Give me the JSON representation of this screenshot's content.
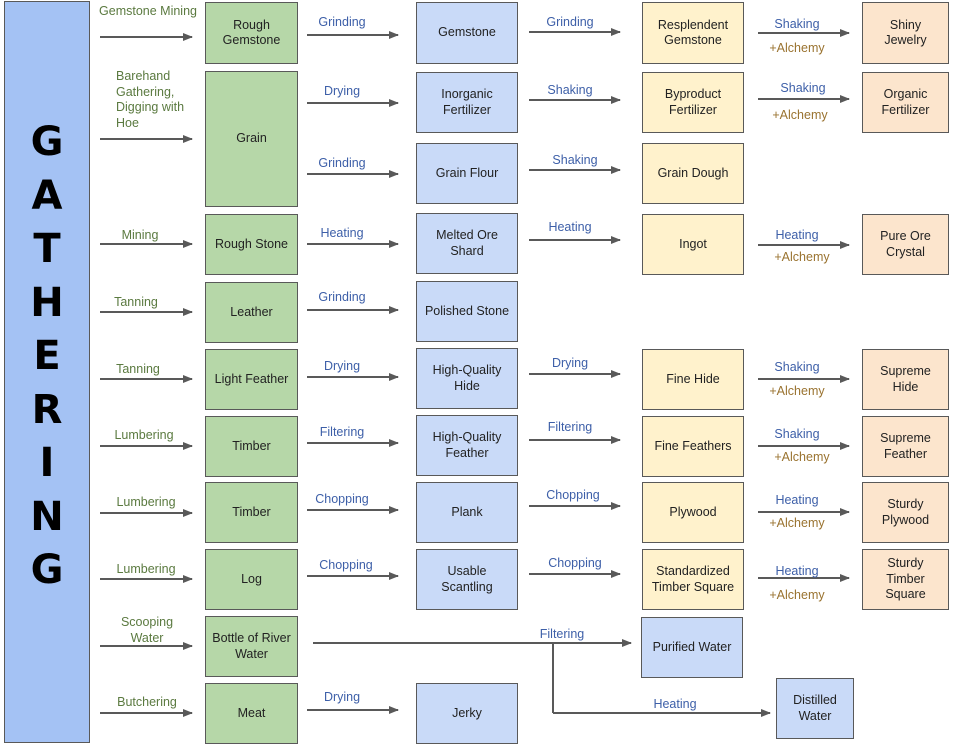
{
  "banner": {
    "title_letters": [
      "G",
      "A",
      "T",
      "H",
      "E",
      "R",
      "I",
      "N",
      "G"
    ]
  },
  "colors": {
    "gathered": "#b6d7a8",
    "processed": "#c9daf8",
    "refined": "#fff2cc",
    "alchemy_product": "#fce5cd",
    "banner": "#a4c2f4",
    "gather_label": "#5b7a40",
    "process_label": "#3d5fa8",
    "alchemy_label": "#9a7330"
  },
  "rows": [
    {
      "gather": "Gemstone Mining",
      "raw": "Rough Gemstone",
      "steps": [
        {
          "process": "Grinding",
          "item": "Gemstone"
        },
        {
          "process": "Grinding",
          "item": "Resplendent Gemstone"
        },
        {
          "process": "Shaking",
          "modifier": "+Alchemy",
          "item": "Shiny Jewelry"
        }
      ]
    },
    {
      "gather": "Barehand Gathering, Digging with Hoe",
      "raw": "Grain",
      "branches": [
        {
          "steps": [
            {
              "process": "Drying",
              "item": "Inorganic Fertilizer"
            },
            {
              "process": "Shaking",
              "item": "Byproduct Fertilizer"
            },
            {
              "process": "Shaking",
              "modifier": "+Alchemy",
              "item": "Organic Fertilizer"
            }
          ]
        },
        {
          "steps": [
            {
              "process": "Grinding",
              "item": "Grain Flour"
            },
            {
              "process": "Shaking",
              "item": "Grain Dough"
            }
          ]
        }
      ]
    },
    {
      "gather": "Mining",
      "raw": "Rough Stone",
      "steps": [
        {
          "process": "Heating",
          "item": "Melted Ore Shard"
        },
        {
          "process": "Heating",
          "item": "Ingot"
        },
        {
          "process": "Heating",
          "modifier": "+Alchemy",
          "item": "Pure Ore Crystal"
        }
      ]
    },
    {
      "gather": "Tanning",
      "raw": "Leather",
      "steps": [
        {
          "process": "Grinding",
          "item": "Polished Stone"
        }
      ]
    },
    {
      "gather": "Tanning",
      "raw": "Light Feather",
      "steps": [
        {
          "process": "Drying",
          "item": "High-Quality Hide"
        },
        {
          "process": "Drying",
          "item": "Fine Hide"
        },
        {
          "process": "Shaking",
          "modifier": "+Alchemy",
          "item": "Supreme Hide"
        }
      ]
    },
    {
      "gather": "Lumbering",
      "raw": "Timber",
      "steps": [
        {
          "process": "Filtering",
          "item": "High-Quality Feather"
        },
        {
          "process": "Filtering",
          "item": "Fine Feathers"
        },
        {
          "process": "Shaking",
          "modifier": "+Alchemy",
          "item": "Supreme Feather"
        }
      ]
    },
    {
      "gather": "Lumbering",
      "raw": "Timber",
      "steps": [
        {
          "process": "Chopping",
          "item": "Plank"
        },
        {
          "process": "Chopping",
          "item": "Plywood"
        },
        {
          "process": "Heating",
          "modifier": "+Alchemy",
          "item": "Sturdy Plywood"
        }
      ]
    },
    {
      "gather": "Lumbering",
      "raw": "Log",
      "steps": [
        {
          "process": "Chopping",
          "item": "Usable Scantling"
        },
        {
          "process": "Chopping",
          "item": "Standardized Timber Square"
        },
        {
          "process": "Heating",
          "modifier": "+Alchemy",
          "item": "Sturdy Timber Square"
        }
      ]
    },
    {
      "gather": "Scooping Water",
      "raw": "Bottle of River Water",
      "steps": [
        {
          "process": "Filtering",
          "item": "Purified Water"
        },
        {
          "process": "Heating",
          "item": "Distilled Water"
        }
      ]
    },
    {
      "gather": "Butchering",
      "raw": "Meat",
      "steps": [
        {
          "process": "Drying",
          "item": "Jerky"
        }
      ]
    }
  ]
}
